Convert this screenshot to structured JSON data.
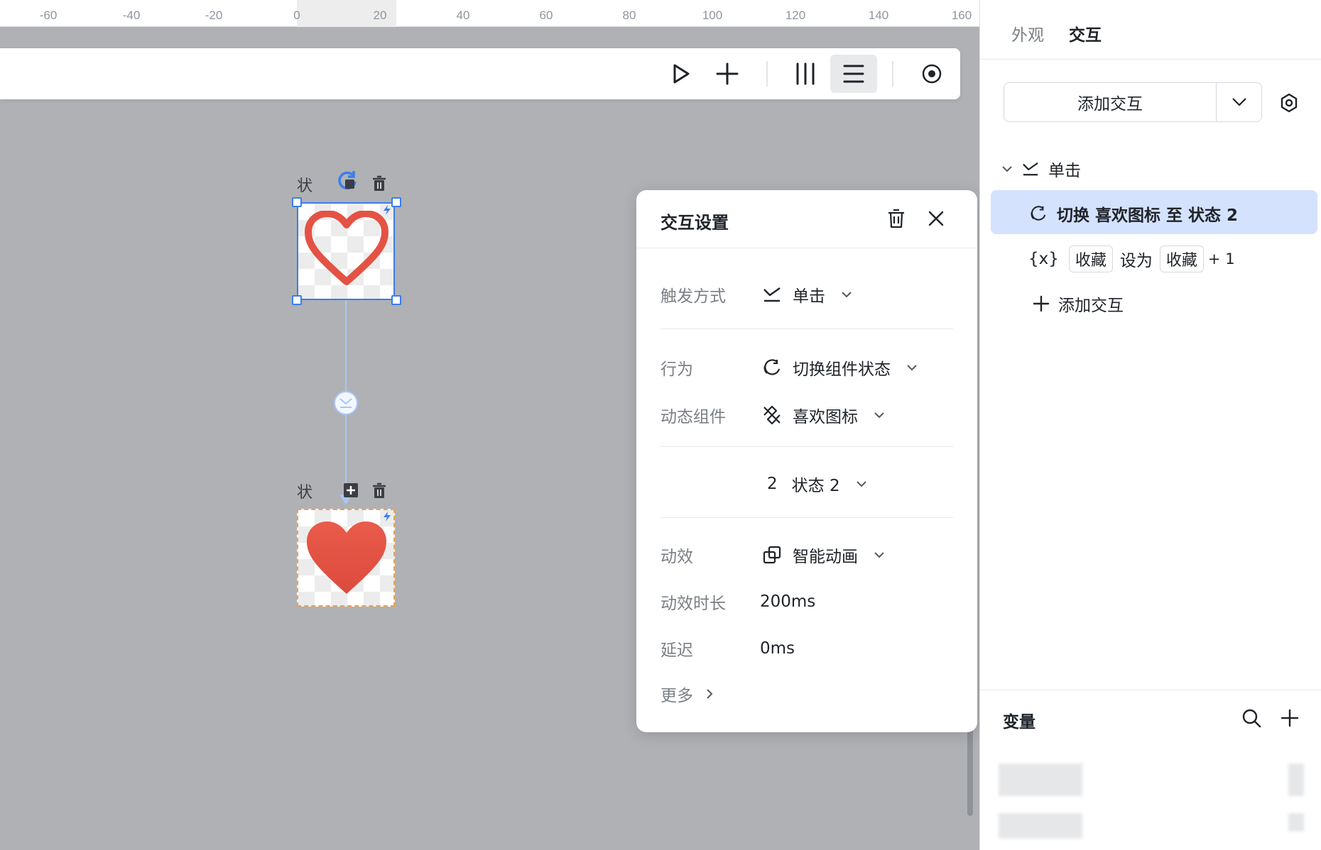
{
  "ruler": {
    "ticks": [
      "-60",
      "-40",
      "-20",
      "0",
      "20",
      "40",
      "60",
      "80",
      "100",
      "120",
      "140",
      "160"
    ]
  },
  "toolbar": {
    "icons": [
      "play-icon",
      "plus-icon",
      "columns-icon",
      "rows-icon",
      "record-icon"
    ]
  },
  "canvas": {
    "state_label_top": "状",
    "state_label_bottom": "状",
    "colors": {
      "selection": "#3b7ded",
      "heart": "#e45243",
      "dashed": "#f0a04b",
      "canvas_bg": "#afb1b5"
    }
  },
  "dialog": {
    "title": "交互设置",
    "trigger_label": "触发方式",
    "trigger_value": "单击",
    "action_label": "行为",
    "action_value": "切换组件状态",
    "component_label": "动态组件",
    "component_value": "喜欢图标",
    "state_number": "2",
    "state_value": "状态 2",
    "effect_label": "动效",
    "effect_value": "智能动画",
    "duration_label": "动效时长",
    "duration_value": "200ms",
    "delay_label": "延迟",
    "delay_value": "0ms",
    "more_label": "更多"
  },
  "panel": {
    "tab_appearance": "外观",
    "tab_interaction": "交互",
    "add_interaction_button": "添加交互",
    "trigger_group": "单击",
    "action_item": "切换 喜欢图标 至 状态 2",
    "var_prefix": "{x}",
    "var_chip_1": "收藏",
    "var_set_to": "设为",
    "var_chip_2": "收藏",
    "var_suffix": "+ 1",
    "add_interaction_link": "添加交互",
    "variables_title": "变量"
  }
}
